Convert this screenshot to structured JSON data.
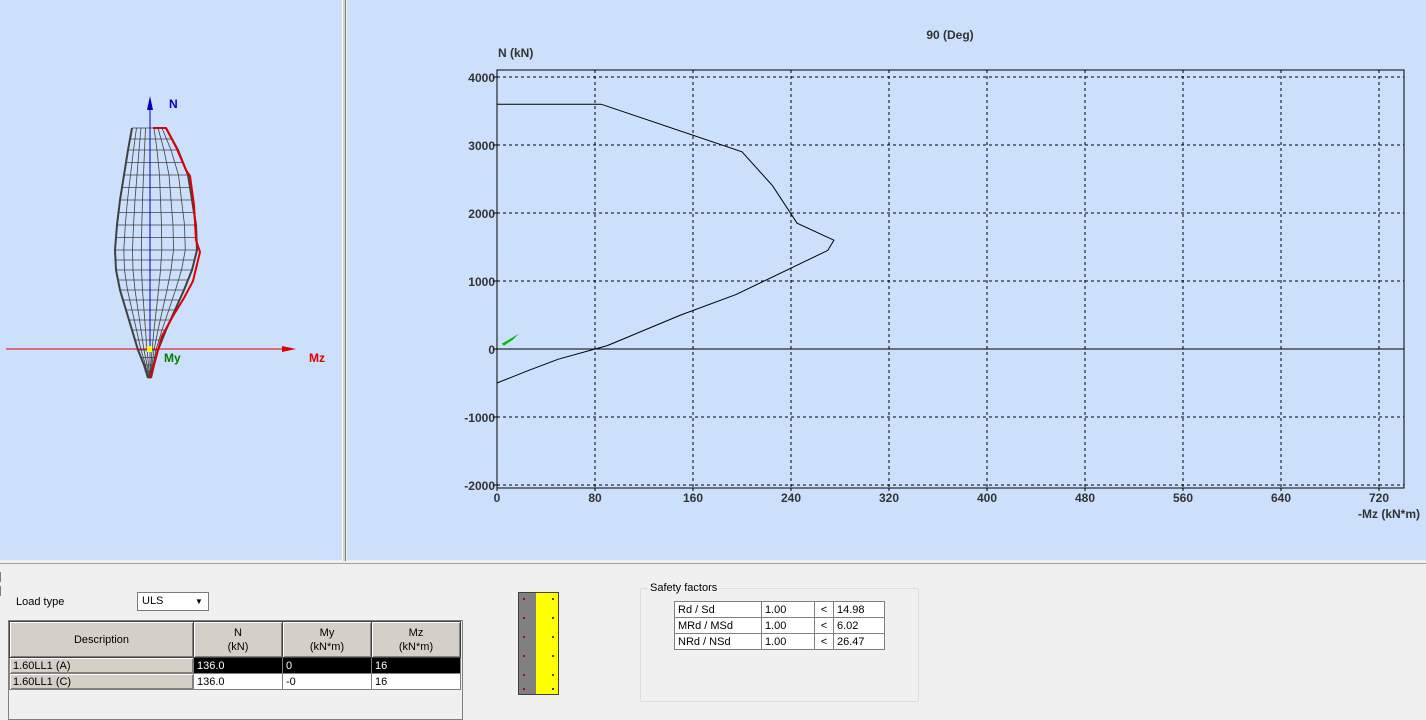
{
  "view3d": {
    "n_label": "N",
    "mz_label": "Mz",
    "my_label": "My",
    "colors": {
      "n_axis": "#0000c0",
      "mz_axis": "#e00000",
      "my_label": "#008000",
      "envelope": "#404040",
      "highlight": "#e00000",
      "point": "#ffff00"
    }
  },
  "chart2d": {
    "title": "90 (Deg)",
    "ylabel": "N (kN)",
    "xlabel": "-Mz (kN*m)"
  },
  "chart_data": {
    "type": "line",
    "title": "90 (Deg)",
    "xlabel": "-Mz (kN*m)",
    "ylabel": "N (kN)",
    "xlim": [
      0,
      740
    ],
    "ylim": [
      -2000,
      4000
    ],
    "xticks": [
      0,
      80,
      160,
      240,
      320,
      400,
      480,
      560,
      640,
      720
    ],
    "yticks": [
      -2000,
      -1000,
      0,
      1000,
      2000,
      3000,
      4000
    ],
    "grid": true,
    "series": [
      {
        "x": [
          0,
          85,
          200,
          225,
          245,
          275,
          270,
          195,
          150,
          90,
          50,
          25,
          0
        ],
        "y": [
          3600,
          3600,
          2900,
          2400,
          1850,
          1600,
          1450,
          800,
          500,
          50,
          -150,
          -320,
          -500
        ]
      }
    ],
    "load_point": {
      "x": 8,
      "y": 136
    }
  },
  "bottom": {
    "load_type_label": "Load type",
    "load_type_value": "ULS",
    "columns": [
      "Description",
      "N\n(kN)",
      "My\n(kN*m)",
      "Mz\n(kN*m)"
    ],
    "rows": [
      {
        "description": "1.60LL1 (A)",
        "n": "136.0",
        "my": "0",
        "mz": "16",
        "selected": true
      },
      {
        "description": "1.60LL1 (C)",
        "n": "136.0",
        "my": "-0",
        "mz": "16",
        "selected": false
      }
    ],
    "safety": {
      "title": "Safety factors",
      "rows": [
        {
          "label": "Rd / Sd",
          "required": "1.00",
          "op": "<",
          "value": "14.98"
        },
        {
          "label": "MRd / MSd",
          "required": "1.00",
          "op": "<",
          "value": "6.02"
        },
        {
          "label": "NRd / NSd",
          "required": "1.00",
          "op": "<",
          "value": "26.47"
        }
      ]
    }
  }
}
